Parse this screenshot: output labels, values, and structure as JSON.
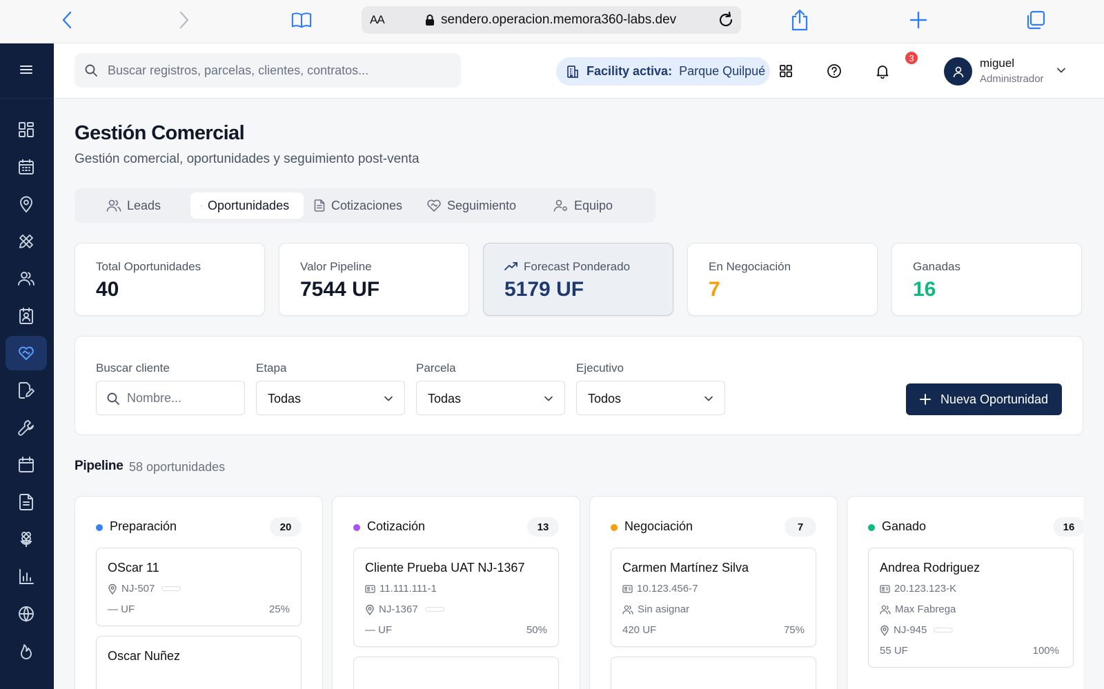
{
  "browser": {
    "aa_label": "AA",
    "url": "sendero.operacion.memora360-labs.dev"
  },
  "topbar": {
    "search_placeholder": "Buscar registros, parcelas, clientes, contratos...",
    "facility_label": "Facility activa:",
    "facility_value": "Parque Quilpué",
    "notifications_count": "3",
    "user_name": "miguel",
    "user_role": "Administrador"
  },
  "page": {
    "title": "Gestión Comercial",
    "subtitle": "Gestión comercial, oportunidades y seguimiento post-venta"
  },
  "tabs": [
    {
      "label": "Leads",
      "active": false
    },
    {
      "label": "Oportunidades",
      "active": true
    },
    {
      "label": "Cotizaciones",
      "active": false
    },
    {
      "label": "Seguimiento",
      "active": false
    },
    {
      "label": "Equipo",
      "active": false
    }
  ],
  "kpis": [
    {
      "label": "Total Oportunidades",
      "value": "40",
      "color": "#111827"
    },
    {
      "label": "Valor Pipeline",
      "value": "7544 UF",
      "color": "#111827"
    },
    {
      "label": "Forecast Ponderado",
      "value": "5179 UF",
      "color": "#1e3a6e"
    },
    {
      "label": "En Negociación",
      "value": "7",
      "color": "#f59e0b"
    },
    {
      "label": "Ganadas",
      "value": "16",
      "color": "#10b981"
    }
  ],
  "filters": {
    "search_label": "Buscar cliente",
    "search_placeholder": "Nombre...",
    "stage_label": "Etapa",
    "stage_value": "Todas",
    "parcel_label": "Parcela",
    "parcel_value": "Todas",
    "exec_label": "Ejecutivo",
    "exec_value": "Todos",
    "new_button": "Nueva Oportunidad"
  },
  "pipeline": {
    "title": "Pipeline",
    "count_label": "58 oportunidades",
    "columns": [
      {
        "name": "Preparación",
        "count": "20",
        "color": "#3b82f6",
        "cards": [
          {
            "title": "OScar 11",
            "parcel": "NJ-507",
            "value": "— UF",
            "pct": "25%"
          },
          {
            "title": "Oscar Nuñez"
          }
        ]
      },
      {
        "name": "Cotización",
        "count": "13",
        "color": "#a855f7",
        "cards": [
          {
            "title": "Cliente Prueba UAT NJ-1367",
            "rut": "11.111.111-1",
            "parcel": "NJ-1367",
            "value": "— UF",
            "pct": "50%"
          }
        ]
      },
      {
        "name": "Negociación",
        "count": "7",
        "color": "#f59e0b",
        "cards": [
          {
            "title": "Carmen Martínez Silva",
            "rut": "10.123.456-7",
            "assignee": "Sin asignar",
            "value": "420 UF",
            "pct": "75%"
          }
        ]
      },
      {
        "name": "Ganado",
        "count": "16",
        "color": "#10b981",
        "cards": [
          {
            "title": "Andrea Rodriguez",
            "rut": "20.123.123-K",
            "assignee": "Max Fabrega",
            "parcel": "NJ-945",
            "value": "55 UF",
            "pct": "100%"
          }
        ]
      }
    ]
  }
}
